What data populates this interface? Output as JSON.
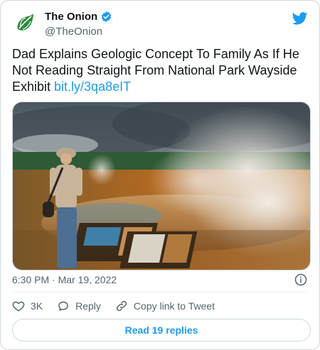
{
  "tweet": {
    "author_name": "The Onion",
    "author_handle": "@TheOnion",
    "text": "Dad Explains Geologic Concept To Family As If He Not Reading Straight From National Park Wayside Exhibit ",
    "link": "bit.ly/3qa8eIT",
    "timestamp": "6:30 PM · Mar 19, 2022"
  },
  "actions": {
    "likes": "3K",
    "reply_label": "Reply",
    "copy_label": "Copy link to Tweet",
    "read_replies": "Read 19 replies"
  },
  "icons": {
    "avatar": "onion-logo-icon",
    "verified": "verified-badge-icon",
    "brand": "twitter-bird-icon",
    "info": "info-icon",
    "like": "heart-icon",
    "reply": "reply-bubble-icon",
    "copy": "link-icon"
  },
  "colors": {
    "accent": "#1d9bf0",
    "logo_green": "#2f8a3b",
    "muted_text": "#536471",
    "border": "#cfd9de"
  }
}
